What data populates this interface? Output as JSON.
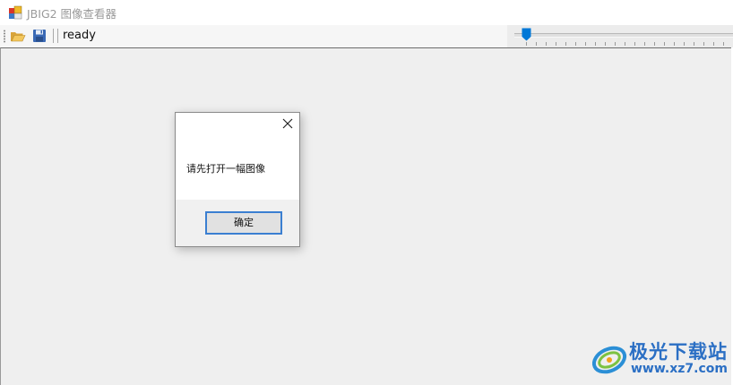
{
  "window": {
    "title": "JBIG2 图像查看器"
  },
  "toolbar": {
    "status": "ready"
  },
  "dialog": {
    "message": "请先打开一幅图像",
    "ok_label": "确定"
  },
  "watermark": {
    "title": "极光下载站",
    "url": "www.xz7.com"
  },
  "colors": {
    "accent": "#0078d7",
    "button_border": "#3b7fd1",
    "watermark": "#2b6fc4",
    "canvas": "#efefef"
  }
}
